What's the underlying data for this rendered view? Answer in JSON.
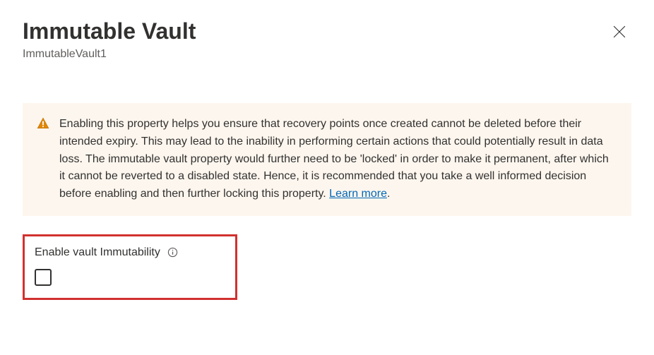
{
  "header": {
    "title": "Immutable Vault",
    "subtitle": "ImmutableVault1"
  },
  "warning": {
    "text": "Enabling this property helps you ensure that recovery points once created cannot be deleted before their intended expiry. This may lead to the inability in performing certain actions that could potentially result in data loss. The immutable vault property would further need to be 'locked' in order to make it permanent, after which it cannot be reverted to a disabled state. Hence, it is recommended that you take a well informed decision before enabling and then further locking this property. ",
    "learn_more_label": "Learn more"
  },
  "checkbox": {
    "label": "Enable vault Immutability"
  }
}
